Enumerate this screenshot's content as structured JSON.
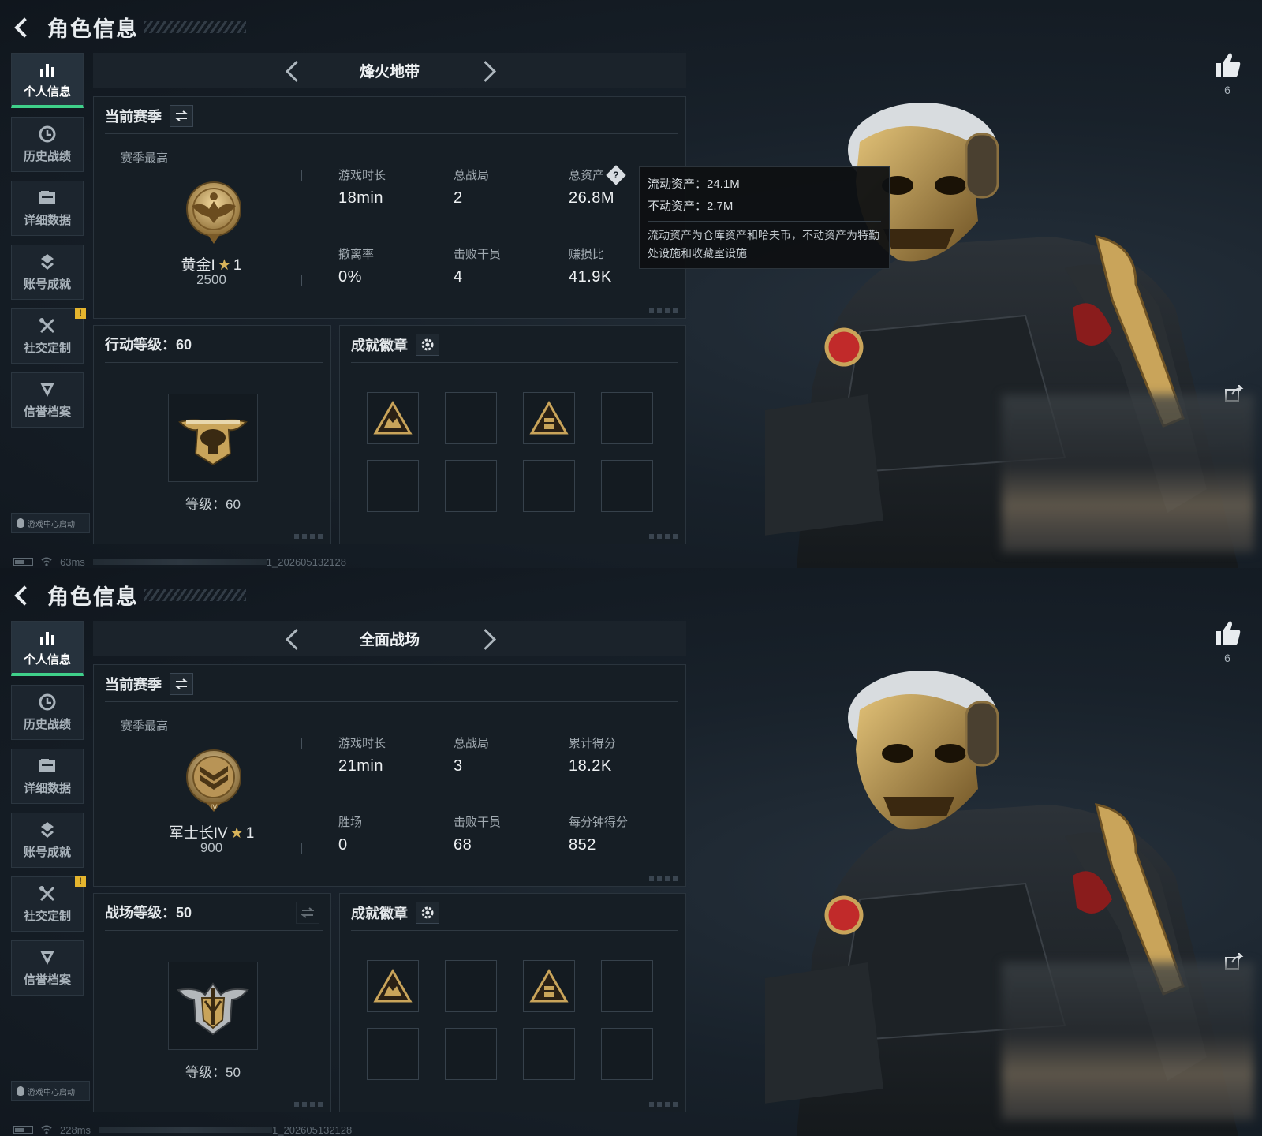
{
  "screens": [
    {
      "header": {
        "title": "角色信息"
      },
      "sidebar": {
        "items": [
          {
            "label": "个人信息",
            "icon": "bar-chart-icon",
            "active": true
          },
          {
            "label": "历史战绩",
            "icon": "history-clock-icon",
            "active": false
          },
          {
            "label": "详细数据",
            "icon": "folder-data-icon",
            "active": false
          },
          {
            "label": "账号成就",
            "icon": "achievement-icon",
            "active": false
          },
          {
            "label": "社交定制",
            "icon": "tools-icon",
            "active": false,
            "badge": "!"
          },
          {
            "label": "信誉档案",
            "icon": "credit-shield-icon",
            "active": false
          }
        ],
        "launch_chip": "游戏中心启动"
      },
      "mode": {
        "title": "烽火地带"
      },
      "season": {
        "title": "当前赛季",
        "best_label": "赛季最高",
        "rank_name": "黄金I",
        "rank_star_icon": "star-icon",
        "rank_stars": "1",
        "rank_score": "2500",
        "stats": [
          {
            "label": "游戏时长",
            "value": "18min"
          },
          {
            "label": "总战局",
            "value": "2"
          },
          {
            "label": "总资产",
            "value": "26.8M",
            "help": true
          },
          {
            "label": "撤离率",
            "value": "0%"
          },
          {
            "label": "击败干员",
            "value": "4"
          },
          {
            "label": "赚损比",
            "value": "41.9K"
          }
        ]
      },
      "tooltip": {
        "line1": "流动资产：24.1M",
        "line2": "不动资产：2.7M",
        "desc": "流动资产为仓库资产和哈夫币，不动资产为特勤处设施和收藏室设施"
      },
      "level": {
        "title": "行动等级：60",
        "caption": "等级：60"
      },
      "badges": {
        "title": "成就徽章",
        "filled": [
          true,
          false,
          true,
          false,
          false,
          false,
          false,
          false
        ]
      },
      "like": {
        "count": "6"
      },
      "status": {
        "ping": "63ms",
        "build": "1_202605132128"
      }
    },
    {
      "header": {
        "title": "角色信息"
      },
      "sidebar": {
        "items": [
          {
            "label": "个人信息",
            "icon": "bar-chart-icon",
            "active": true
          },
          {
            "label": "历史战绩",
            "icon": "history-clock-icon",
            "active": false
          },
          {
            "label": "详细数据",
            "icon": "folder-data-icon",
            "active": false
          },
          {
            "label": "账号成就",
            "icon": "achievement-icon",
            "active": false
          },
          {
            "label": "社交定制",
            "icon": "tools-icon",
            "active": false,
            "badge": "!"
          },
          {
            "label": "信誉档案",
            "icon": "credit-shield-icon",
            "active": false
          }
        ],
        "launch_chip": "游戏中心启动"
      },
      "mode": {
        "title": "全面战场"
      },
      "season": {
        "title": "当前赛季",
        "best_label": "赛季最高",
        "rank_name": "军士长IV",
        "rank_star_icon": "star-icon",
        "rank_stars": "1",
        "rank_score": "900",
        "stats": [
          {
            "label": "游戏时长",
            "value": "21min"
          },
          {
            "label": "总战局",
            "value": "3"
          },
          {
            "label": "累计得分",
            "value": "18.2K"
          },
          {
            "label": "胜场",
            "value": "0"
          },
          {
            "label": "击败干员",
            "value": "68"
          },
          {
            "label": "每分钟得分",
            "value": "852"
          }
        ]
      },
      "level": {
        "title": "战场等级：50",
        "caption": "等级：50"
      },
      "badges": {
        "title": "成就徽章",
        "filled": [
          true,
          false,
          true,
          false,
          false,
          false,
          false,
          false
        ]
      },
      "like": {
        "count": "6"
      },
      "status": {
        "ping": "228ms",
        "build": "1_202605132128"
      }
    }
  ],
  "colors": {
    "accent_green": "#3fd08a",
    "gold": "#c9a45a",
    "warning": "#e5b52e",
    "panel_bg": "#161e25"
  }
}
